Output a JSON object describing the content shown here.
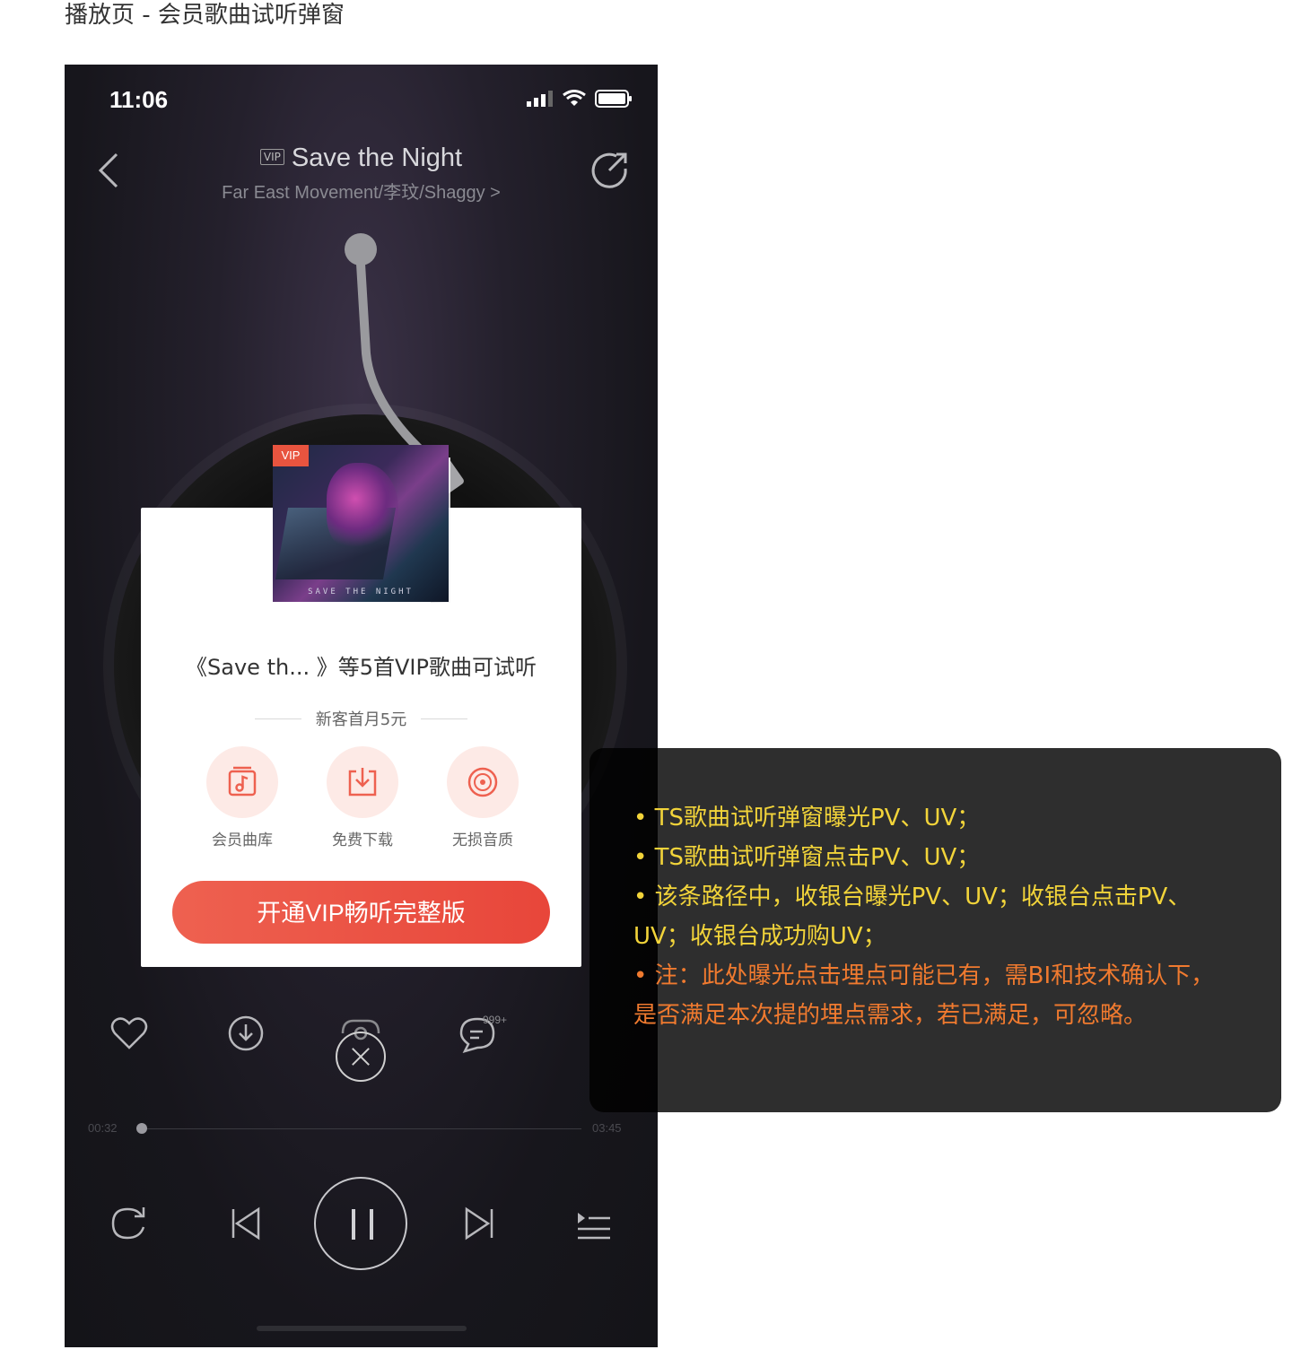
{
  "caption": "播放页 - 会员歌曲试听弹窗",
  "status_bar": {
    "time": "11:06"
  },
  "header": {
    "vip_tag": "VIP",
    "song_title": "Save the Night",
    "artists": "Far East Movement/李玟/Shaggy >"
  },
  "album": {
    "badge": "VIP",
    "cover_text": "SAVE THE NIGHT"
  },
  "modal": {
    "title": "《Save th... 》等5首VIP歌曲可试听",
    "offer": "新客首月5元",
    "features": [
      {
        "label": "会员曲库",
        "icon": "music-library-icon"
      },
      {
        "label": "免费下载",
        "icon": "download-icon"
      },
      {
        "label": "无损音质",
        "icon": "lossless-disc-icon"
      }
    ],
    "cta_label": "开通VIP畅听完整版"
  },
  "player": {
    "comment_count": "999+",
    "time_elapsed": "00:32",
    "time_total": "03:45",
    "progress": 0.02
  },
  "annotation": {
    "lines": [
      "• TS歌曲试听弹窗曝光PV、UV；",
      "• TS歌曲试听弹窗点击PV、UV；",
      "• 该条路径中，收银台曝光PV、UV；收银台点击PV、",
      "UV；收银台成功购UV；",
      "• 注：此处曝光点击埋点可能已有，需BI和技术确认下，",
      "是否满足本次提的埋点需求，若已满足，可忽略。"
    ],
    "colors": {
      "normal": "#f2d43a",
      "note": "#f07a2f"
    }
  }
}
